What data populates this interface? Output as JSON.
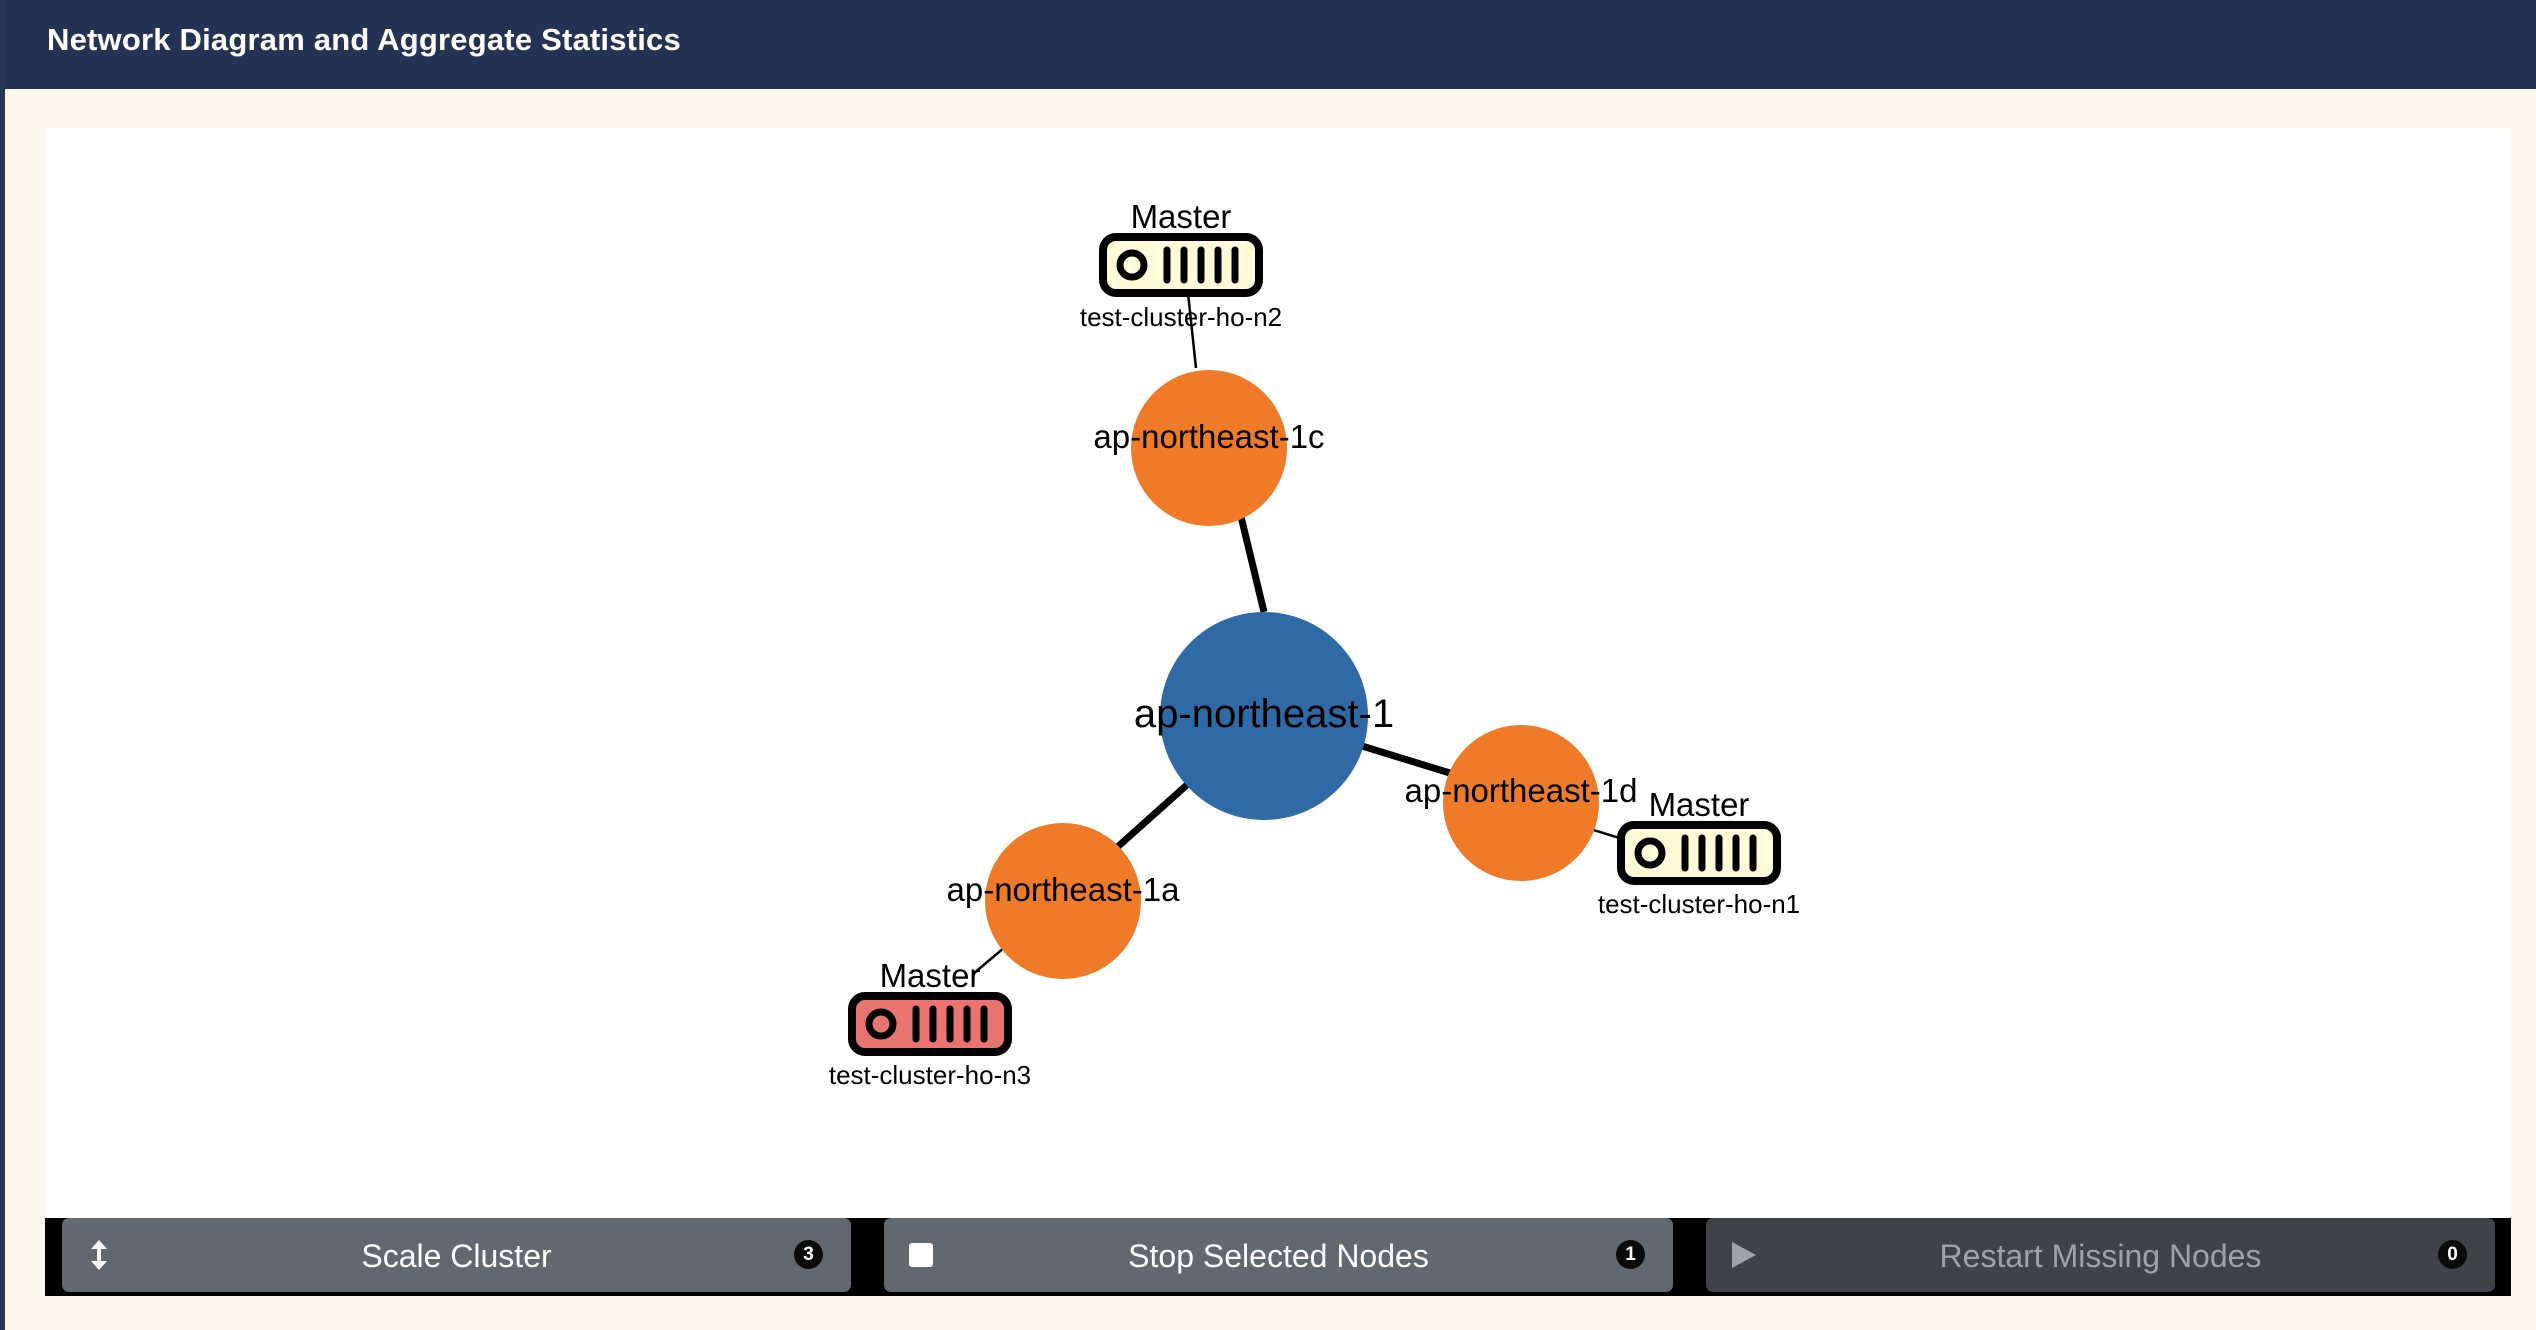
{
  "header": {
    "title": "Network Diagram and Aggregate Statistics"
  },
  "colors": {
    "header_bg": "#243353",
    "region": "#2f6aa6",
    "zone": "#ef7b29",
    "node_ok": "#fffbd8",
    "node_alert": "#e9736e",
    "button": "#626870",
    "button_disabled": "#3f4348"
  },
  "diagram": {
    "region": {
      "label": "ap-northeast-1"
    },
    "zones": [
      {
        "label": "ap-northeast-1c"
      },
      {
        "label": "ap-northeast-1d"
      },
      {
        "label": "ap-northeast-1a"
      }
    ],
    "nodes": [
      {
        "role": "Master",
        "name": "test-cluster-ho-n2",
        "state": "ok"
      },
      {
        "role": "Master",
        "name": "test-cluster-ho-n1",
        "state": "ok"
      },
      {
        "role": "Master",
        "name": "test-cluster-ho-n3",
        "state": "alert"
      }
    ]
  },
  "actions": [
    {
      "label": "Scale Cluster",
      "icon": "vertical-resize-icon",
      "badge": "3",
      "enabled": true
    },
    {
      "label": "Stop Selected Nodes",
      "icon": "stop-icon",
      "badge": "1",
      "enabled": true
    },
    {
      "label": "Restart Missing Nodes",
      "icon": "play-icon",
      "badge": "0",
      "enabled": false
    }
  ]
}
